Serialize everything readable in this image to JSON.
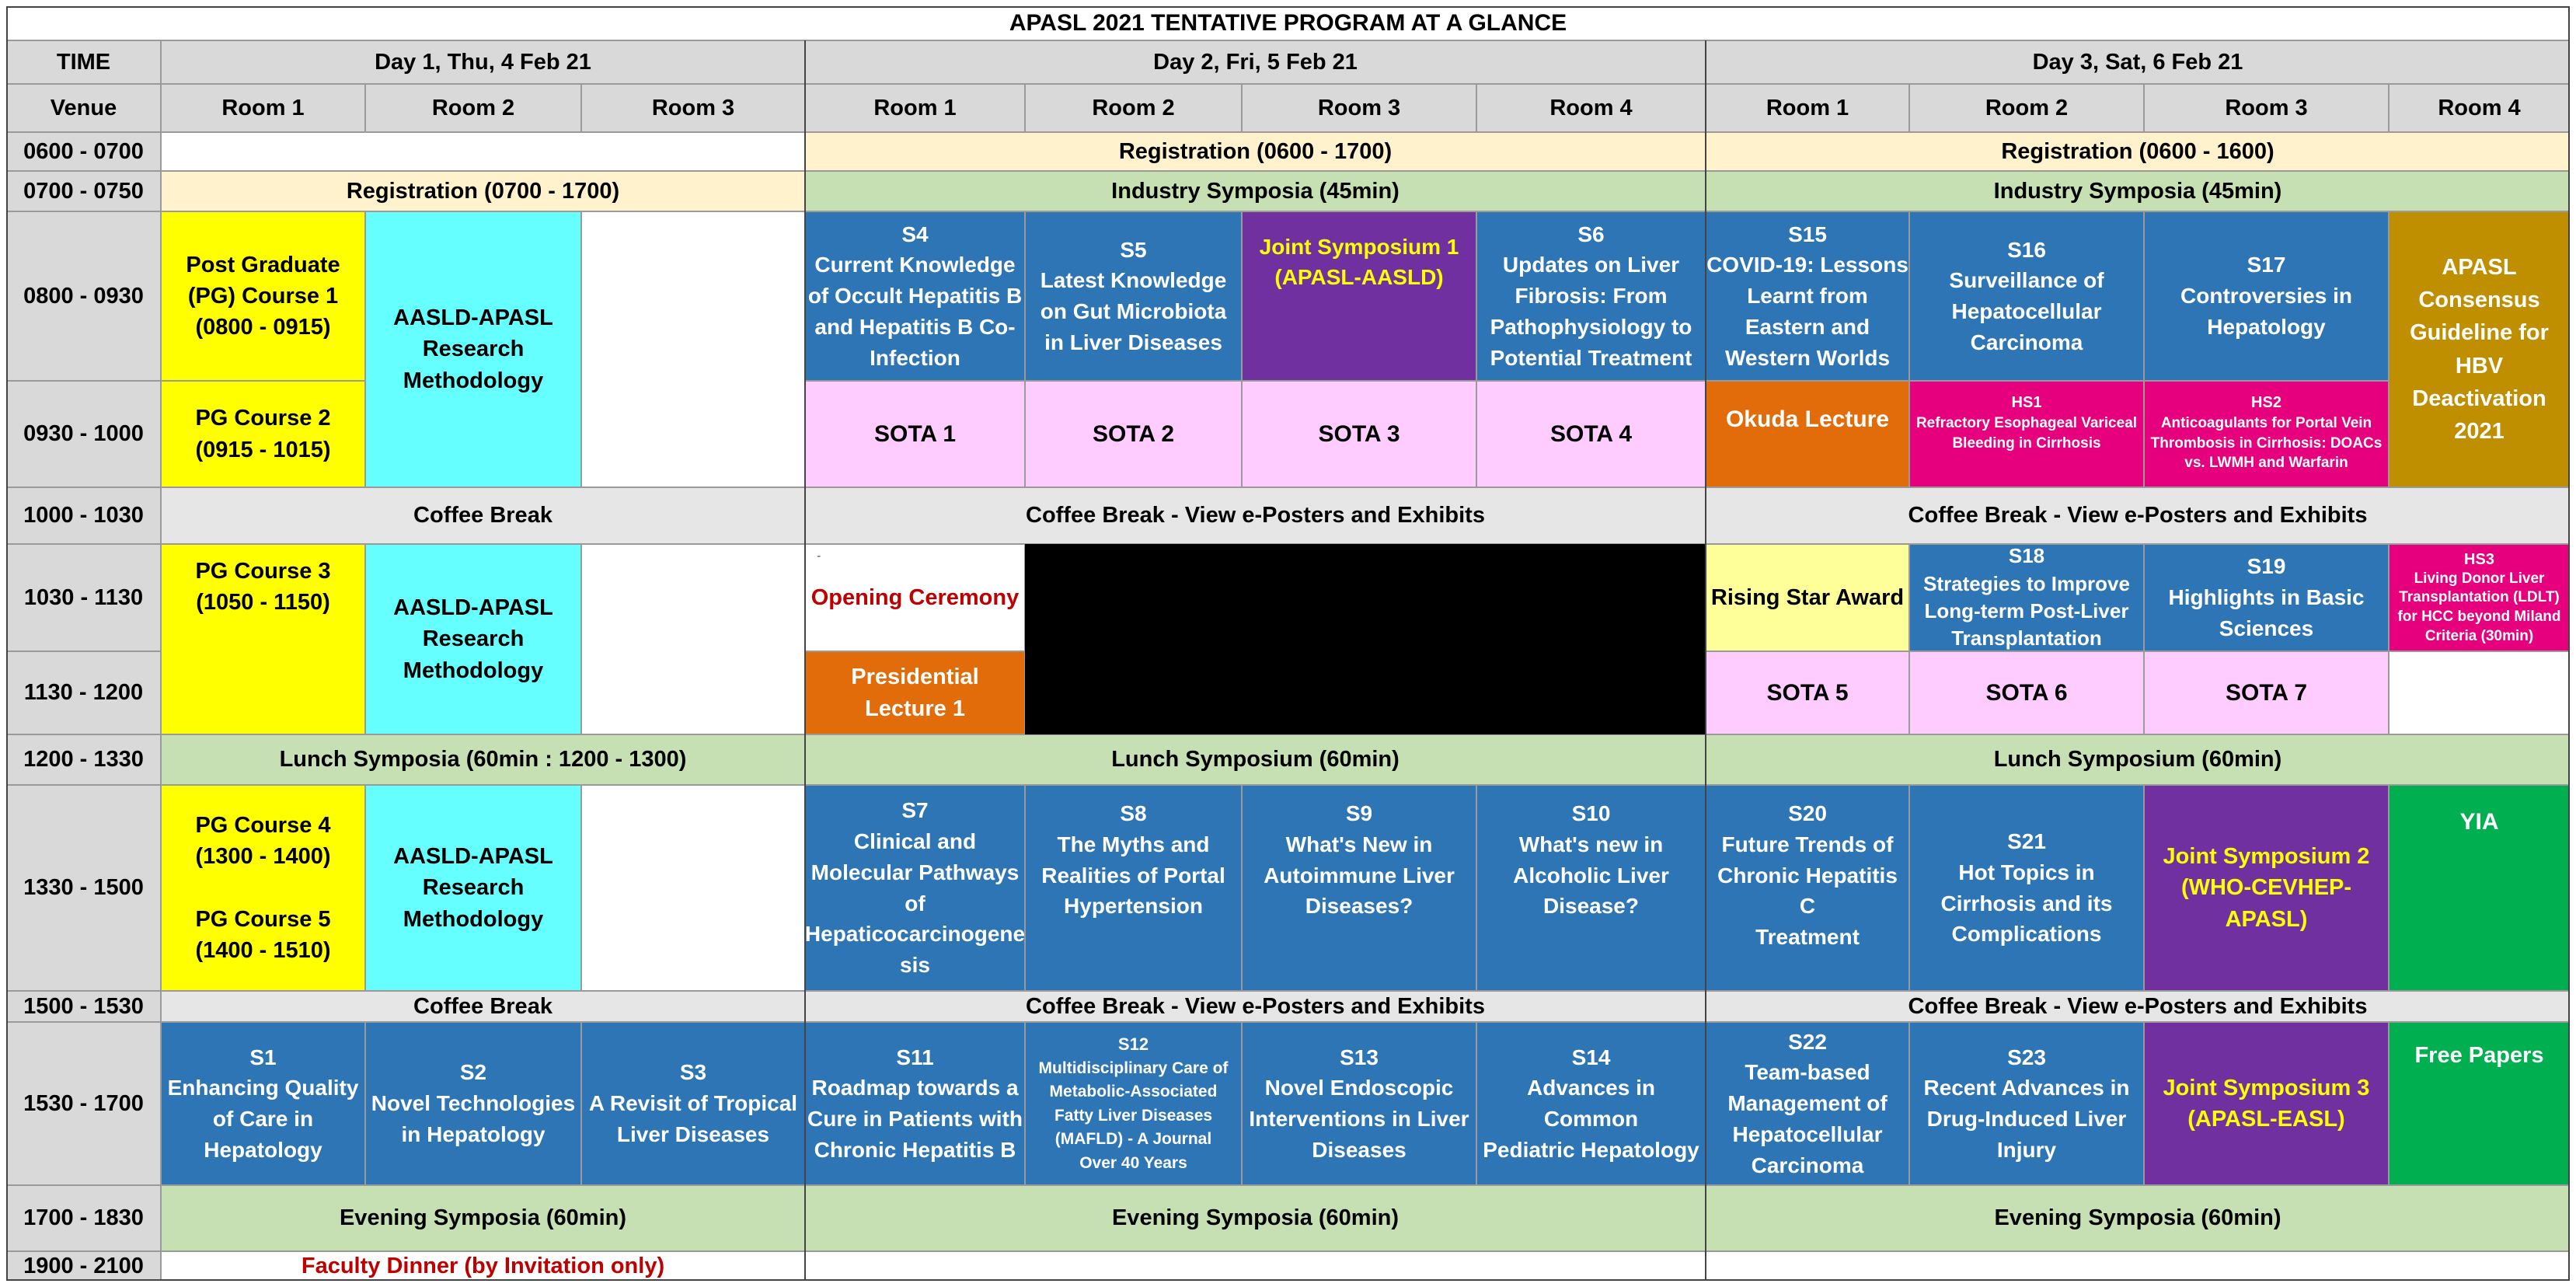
{
  "title": "APASL 2021 TENTATIVE PROGRAM AT A GLANCE",
  "colors": {
    "header_gray": "#d9d9d9",
    "registration_beige": "#fff2cc",
    "green_band": "#c6e0b4",
    "blue_session": "#2e75b6",
    "purple_joint": "#7030a0",
    "pink_sota": "#ffccff",
    "yellow_course": "#ffff00",
    "cyan_course": "#66ffff",
    "orange_lecture": "#e26b0a",
    "magenta_hs": "#e6007e",
    "gold_consensus": "#bf8f00",
    "green_yia": "#00b050",
    "coffee_gray": "#e7e6e6",
    "red_text": "#c00000",
    "yellow_text": "#ffff00"
  },
  "header": {
    "time": "TIME",
    "venue": "Venue",
    "day1": "Day 1, Thu, 4 Feb 21",
    "day2": "Day 2, Fri, 5 Feb 21",
    "day3": "Day 3, Sat, 6 Feb 21",
    "room1": "Room 1",
    "room2": "Room 2",
    "room3": "Room 3",
    "room4": "Room 4"
  },
  "times": {
    "t0600": "0600 - 0700",
    "t0700": "0700 - 0750",
    "t0800": "0800 - 0930",
    "t0930": "0930 - 1000",
    "t1000": "1000 - 1030",
    "t1030": "1030 - 1130",
    "t1130": "1130 - 1200",
    "t1200": "1200 - 1330",
    "t1330": "1330 - 1500",
    "t1500": "1500 - 1530",
    "t1530": "1530 - 1700",
    "t1700": "1700 - 1830",
    "t1900": "1900 - 2100"
  },
  "cells": {
    "reg_d2_0600": "Registration (0600 - 1700)",
    "reg_d3_0600": "Registration (0600 - 1600)",
    "reg_d1_0700": "Registration (0700 - 1700)",
    "ind_d2": "Industry Symposia (45min)",
    "ind_d3": "Industry Symposia (45min)",
    "pg1": [
      "Post Graduate",
      "(PG) Course 1",
      "(0800 - 0915)"
    ],
    "pg2": [
      "PG Course 2",
      "(0915 - 1015)"
    ],
    "aasld1": [
      "AASLD-APASL",
      "Research",
      "Methodology"
    ],
    "s4": [
      "S4",
      "Current Knowledge",
      "of Occult Hepatitis B",
      "and Hepatitis B Co-",
      "Infection"
    ],
    "s5": [
      "S5",
      "Latest Knowledge",
      "on Gut Microbiota",
      "in Liver Diseases"
    ],
    "js1": [
      "Joint Symposium 1",
      "(APASL-AASLD)"
    ],
    "s6": [
      "S6",
      "Updates on Liver",
      "Fibrosis: From",
      "Pathophysiology to",
      "Potential Treatment"
    ],
    "s15": [
      "S15",
      "COVID-19: Lessons",
      "Learnt from",
      "Eastern and",
      "Western Worlds"
    ],
    "s16": [
      "S16",
      "Surveillance of",
      "Hepatocellular",
      "Carcinoma"
    ],
    "s17": [
      "S17",
      "Controversies in",
      "Hepatology"
    ],
    "consensus": [
      "APASL",
      "Consensus",
      "Guideline for",
      "HBV",
      "Deactivation",
      "2021"
    ],
    "sota1": "SOTA 1",
    "sota2": "SOTA 2",
    "sota3": "SOTA 3",
    "sota4": "SOTA 4",
    "okuda": "Okuda Lecture",
    "hs1": [
      "HS1",
      "Refractory Esophageal Variceal",
      "Bleeding in Cirrhosis"
    ],
    "hs2": [
      "HS2",
      "Anticoagulants for Portal Vein",
      "Thrombosis in Cirrhosis: DOACs",
      "vs. LWMH and Warfarin"
    ],
    "coffee_d1_1000": "Coffee Break",
    "coffee_d2_1000": "Coffee Break - View e-Posters and Exhibits",
    "coffee_d3_1000": "Coffee Break - View e-Posters and Exhibits",
    "pg3": [
      "PG Course 3",
      "(1050 - 1150)"
    ],
    "aasld2": [
      "AASLD-APASL",
      "Research",
      "Methodology"
    ],
    "dash": "-",
    "opening": "Opening Ceremony",
    "presidential": [
      "Presidential",
      "Lecture 1"
    ],
    "rising": "Rising Star Award",
    "s18": [
      "S18",
      "Strategies to Improve",
      "Long-term Post-Liver",
      "Transplantation"
    ],
    "s19": [
      "S19",
      "Highlights in Basic",
      "Sciences"
    ],
    "hs3": [
      "HS3",
      "Living Donor Liver",
      "Transplantation (LDLT)",
      "for HCC beyond Miland",
      "Criteria (30min)"
    ],
    "sota5": "SOTA 5",
    "sota6": "SOTA 6",
    "sota7": "SOTA 7",
    "lunch_d1": "Lunch Symposia (60min : 1200 - 1300)",
    "lunch_d2": "Lunch Symposium (60min)",
    "lunch_d3": "Lunch Symposium (60min)",
    "pg45": [
      "PG Course 4",
      "(1300 - 1400)",
      "",
      "PG Course 5",
      "(1400 - 1510)"
    ],
    "aasld3": [
      "AASLD-APASL",
      "Research",
      "Methodology"
    ],
    "s7": [
      "S7",
      "Clinical and",
      "Molecular Pathways",
      "of",
      "Hepaticocarcinogene",
      "sis"
    ],
    "s8": [
      "S8",
      "The Myths and",
      "Realities  of Portal",
      "Hypertension"
    ],
    "s9": [
      "S9",
      "What's New in",
      "Autoimmune Liver",
      "Diseases?"
    ],
    "s10": [
      "S10",
      "What's new in",
      "Alcoholic Liver",
      "Disease?"
    ],
    "s20": [
      "S20",
      "Future Trends of",
      "Chronic Hepatitis C",
      "Treatment"
    ],
    "s21": [
      "S21",
      "Hot Topics in",
      "Cirrhosis and its",
      "Complications"
    ],
    "js2": [
      "Joint Symposium 2",
      "(WHO-CEVHEP-",
      "APASL)"
    ],
    "yia": "YIA",
    "coffee_d1_1500": "Coffee Break",
    "coffee_d2_1500": "Coffee Break - View e-Posters and Exhibits",
    "coffee_d3_1500": "Coffee Break - View e-Posters and Exhibits",
    "s1": [
      "S1",
      "Enhancing Quality",
      "of Care in",
      "Hepatology"
    ],
    "s2": [
      "S2",
      "Novel Technologies",
      "in Hepatology"
    ],
    "s3": [
      "S3",
      "A Revisit of Tropical",
      "Liver Diseases"
    ],
    "s11": [
      "S11",
      "Roadmap towards a",
      "Cure in Patients with",
      "Chronic Hepatitis B"
    ],
    "s12": [
      "S12",
      "Multidisciplinary Care of",
      "Metabolic-Associated",
      "Fatty Liver Diseases",
      "(MAFLD) - A Journal",
      "Over 40 Years"
    ],
    "s13": [
      "S13",
      "Novel Endoscopic",
      "Interventions in Liver",
      "Diseases"
    ],
    "s14": [
      "S14",
      "Advances in Common",
      "Pediatric Hepatology"
    ],
    "s22": [
      "S22",
      "Team-based",
      "Management of",
      "Hepatocellular",
      "Carcinoma"
    ],
    "s23": [
      "S23",
      "Recent Advances in",
      "Drug-Induced Liver",
      "Injury"
    ],
    "js3": [
      "Joint Symposium 3",
      "(APASL-EASL)"
    ],
    "free": "Free Papers",
    "evening_d1": "Evening Symposia (60min)",
    "evening_d2": "Evening Symposia (60min)",
    "evening_d3": "Evening Symposia (60min)",
    "faculty": "Faculty Dinner (by Invitation only)"
  }
}
